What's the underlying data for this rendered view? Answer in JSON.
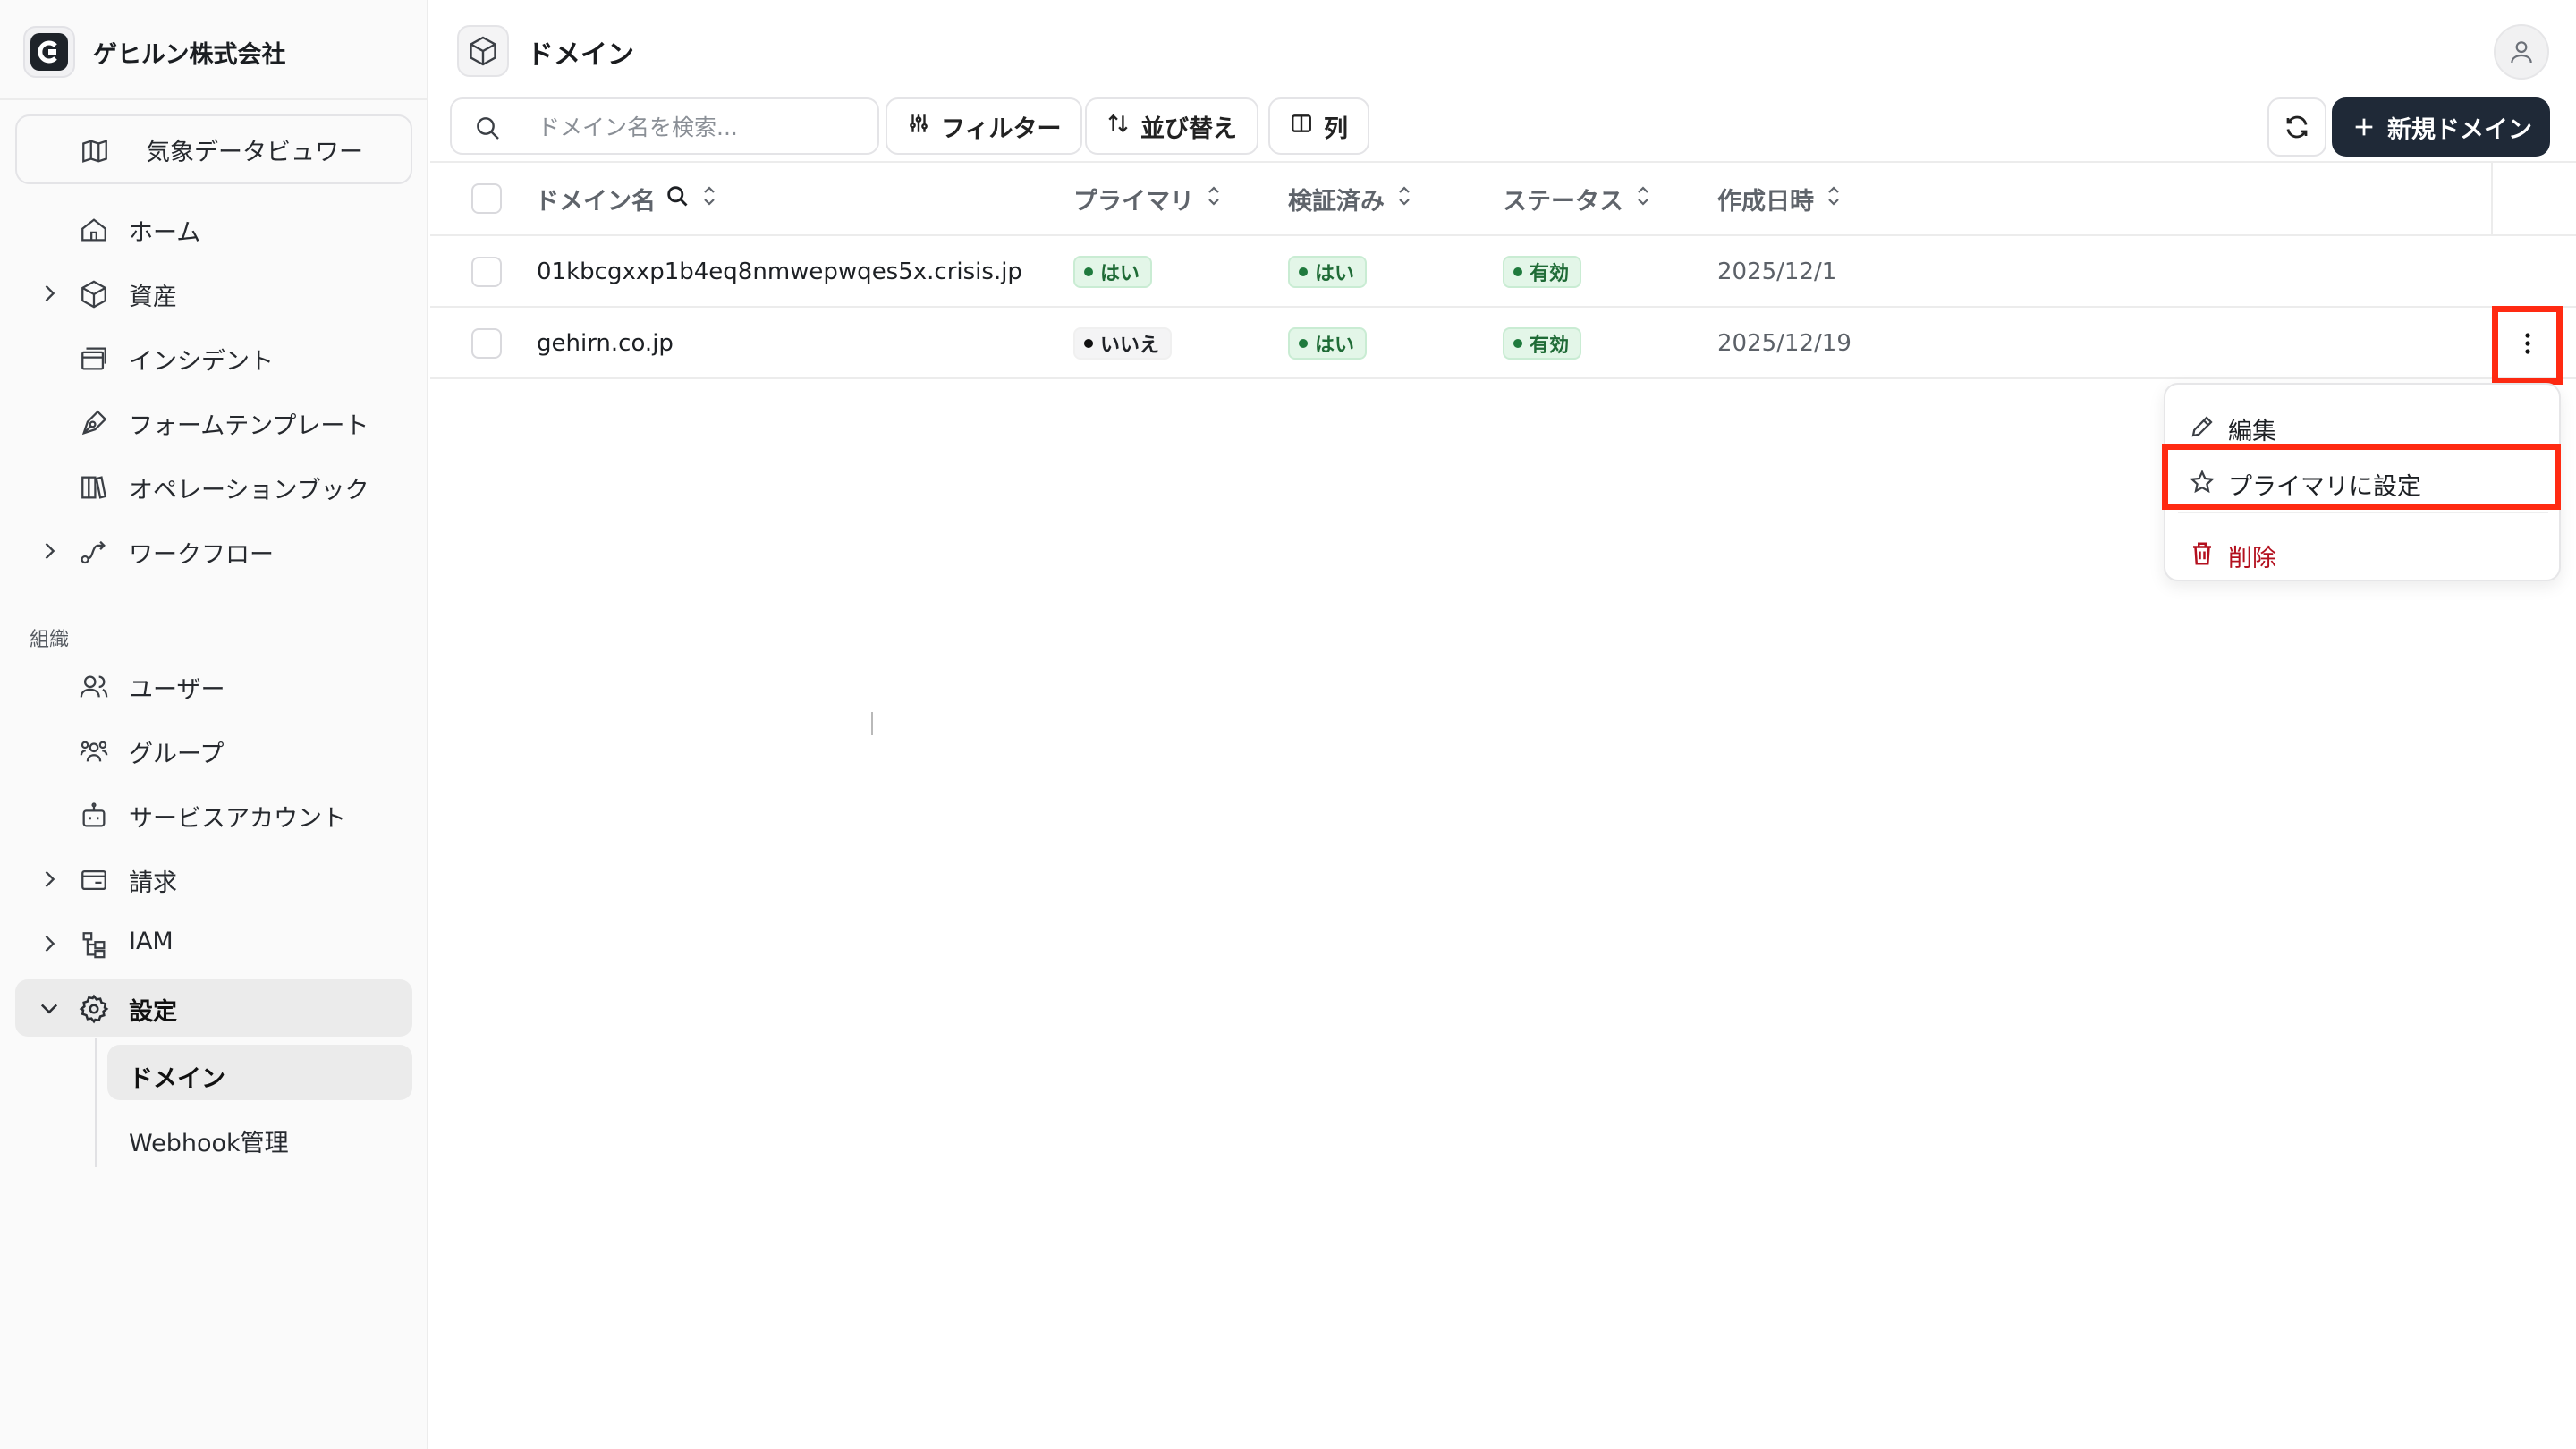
{
  "sidebar": {
    "org_name": "ゲヒルン株式会社",
    "special_item": "気象データビュワー",
    "items": [
      {
        "label": "ホーム",
        "icon": "home-icon"
      },
      {
        "label": "資産",
        "icon": "box-icon"
      },
      {
        "label": "インシデント",
        "icon": "window-icon"
      },
      {
        "label": "フォームテンプレート",
        "icon": "pen-icon"
      },
      {
        "label": "オペレーションブック",
        "icon": "books-icon"
      },
      {
        "label": "ワークフロー",
        "icon": "route-icon"
      }
    ],
    "group_label": "組織",
    "org_items": [
      {
        "label": "ユーザー",
        "icon": "users-icon"
      },
      {
        "label": "グループ",
        "icon": "group-icon"
      },
      {
        "label": "サービスアカウント",
        "icon": "bot-icon"
      },
      {
        "label": "請求",
        "icon": "wallet-icon"
      },
      {
        "label": "IAM",
        "icon": "network-icon"
      },
      {
        "label": "設定",
        "icon": "gear-icon"
      }
    ],
    "sub_items": [
      {
        "label": "ドメイン"
      },
      {
        "label": "Webhook管理"
      }
    ]
  },
  "header": {
    "title": "ドメイン"
  },
  "toolbar": {
    "search_placeholder": "ドメイン名を検索...",
    "filter_label": "フィルター",
    "sort_label": "並び替え",
    "columns_label": "列",
    "new_label": "新規ドメイン"
  },
  "table": {
    "headers": {
      "domain": "ドメイン名",
      "primary": "プライマリ",
      "verified": "検証済み",
      "status": "ステータス",
      "created": "作成日時"
    },
    "rows": [
      {
        "domain": "01kbcgxxp1b4eq8nmwepwqes5x.crisis.jp",
        "primary": "はい",
        "verified": "はい",
        "status": "有効",
        "created": "2025/12/1"
      },
      {
        "domain": "gehirn.co.jp",
        "primary": "いいえ",
        "verified": "はい",
        "status": "有効",
        "created": "2025/12/19"
      }
    ]
  },
  "menu": {
    "edit": "編集",
    "set_primary": "プライマリに設定",
    "delete": "削除"
  },
  "colors": {
    "accent": "#1f2937",
    "highlight": "#ff2a12",
    "success_bg": "#e3f6e8",
    "success_text": "#1f6b36",
    "danger": "#b3101e"
  }
}
